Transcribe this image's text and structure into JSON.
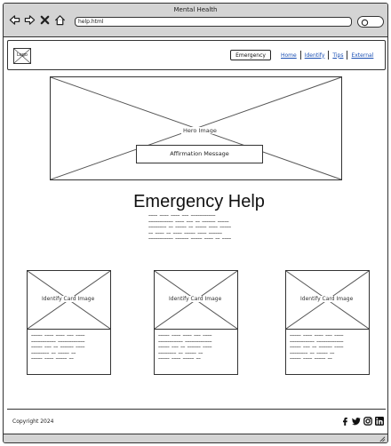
{
  "window": {
    "title": "Mental Health"
  },
  "browser": {
    "address": "help.html",
    "icons": [
      "back-icon",
      "forward-icon",
      "close-icon",
      "home-icon",
      "search-icon"
    ]
  },
  "header": {
    "logo_label": "Logo",
    "emergency_button": "Emergency",
    "nav": [
      {
        "label": "Home"
      },
      {
        "label": "Identify"
      },
      {
        "label": "Tips"
      },
      {
        "label": "External"
      }
    ]
  },
  "hero": {
    "image_caption": "Hero Image",
    "affirmation": "Affirmation Message"
  },
  "main": {
    "heading": "Emergency Help"
  },
  "cards": [
    {
      "image_caption": "Identify Card Image"
    },
    {
      "image_caption": "Identify Card Image"
    },
    {
      "image_caption": "Identify Card Image"
    }
  ],
  "footer": {
    "copyright": "Copyright 2024",
    "social_icons": [
      "facebook-icon",
      "twitter-icon",
      "instagram-icon",
      "linkedin-icon"
    ]
  },
  "colors": {
    "chrome": "#d4d4d4",
    "link": "#1a4fb4",
    "stroke": "#333333"
  }
}
